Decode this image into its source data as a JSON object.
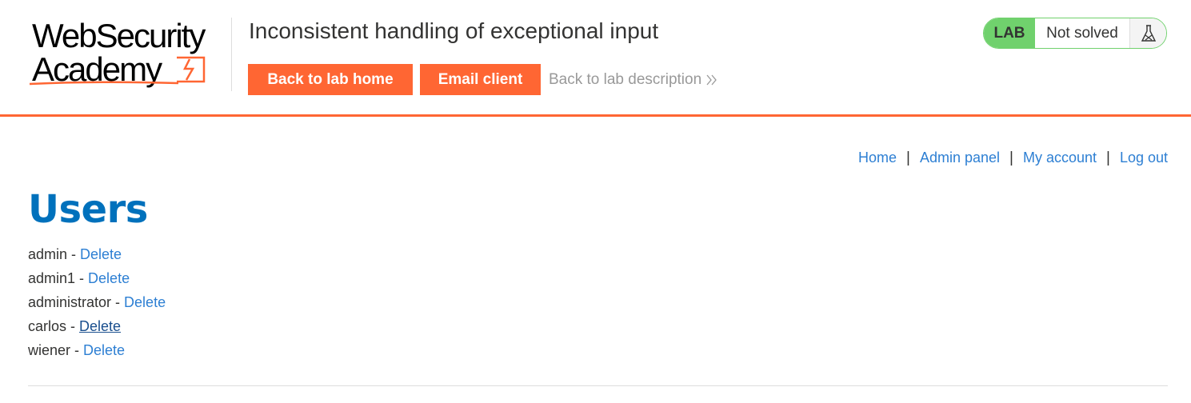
{
  "header": {
    "logo": {
      "line1": "WebSecurity",
      "line2": "Academy",
      "icon": "lightning-bolt-logo-mark"
    },
    "lab_title": "Inconsistent handling of exceptional input",
    "buttons": {
      "back_to_lab_home": "Back to lab home",
      "email_client": "Email client"
    },
    "description_link": {
      "label": "Back to lab description",
      "icon": "double-chevron-right-icon"
    },
    "status": {
      "badge": "LAB",
      "text": "Not solved",
      "icon": "flask-icon"
    },
    "colors": {
      "accent": "#ff6633",
      "status_green": "#70d16d",
      "link": "#2d7fd3",
      "heading": "#0071bc"
    }
  },
  "nav": {
    "home": "Home",
    "separator": "|",
    "admin_panel": "Admin panel",
    "my_account": "My account",
    "log_out": "Log out"
  },
  "main": {
    "title": "Users",
    "users": [
      {
        "name": "admin",
        "dash": " - ",
        "action": "Delete"
      },
      {
        "name": "admin1",
        "dash": " - ",
        "action": "Delete"
      },
      {
        "name": "administrator",
        "dash": " - ",
        "action": "Delete"
      },
      {
        "name": "carlos",
        "dash": " - ",
        "action": "Delete"
      },
      {
        "name": "wiener",
        "dash": " - ",
        "action": "Delete"
      }
    ]
  }
}
